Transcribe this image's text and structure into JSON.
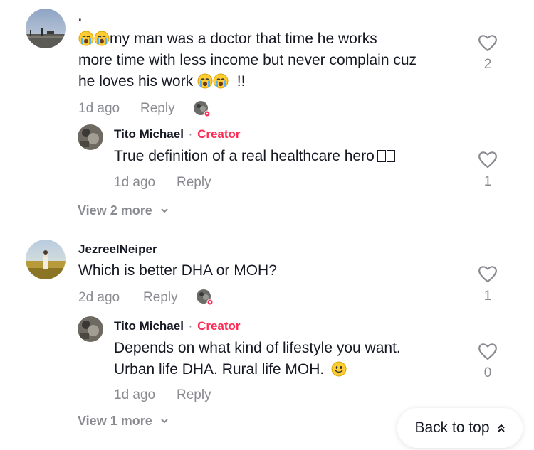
{
  "colors": {
    "creator": "#fe2c55",
    "muted": "#8a8b91",
    "text": "#161823"
  },
  "comments": [
    {
      "username": ".",
      "text_line1": "my man was a doctor that time he works",
      "text_line2": "more time with less income but never complain cuz",
      "text_line3": "he loves his work",
      "text_tail": "!!",
      "time": "1d ago",
      "reply_label": "Reply",
      "like_count": "2",
      "reply": {
        "username": "Tito Michael",
        "separator": "·",
        "badge": "Creator",
        "text": "True definition of a real healthcare hero",
        "time": "1d ago",
        "reply_label": "Reply",
        "like_count": "1"
      },
      "view_more": "View 2 more"
    },
    {
      "username": "JezreelNeiper",
      "text_line1": "Which is better DHA or MOH?",
      "time": "2d ago",
      "reply_label": "Reply",
      "like_count": "1",
      "reply": {
        "username": "Tito Michael",
        "separator": "·",
        "badge": "Creator",
        "text_line1": "Depends on what kind of lifestyle you want.",
        "text_line2": "Urban life DHA. Rural life MOH.",
        "time": "1d ago",
        "reply_label": "Reply",
        "like_count": "0"
      },
      "view_more": "View 1 more"
    }
  ],
  "back_to_top": "Back to top"
}
